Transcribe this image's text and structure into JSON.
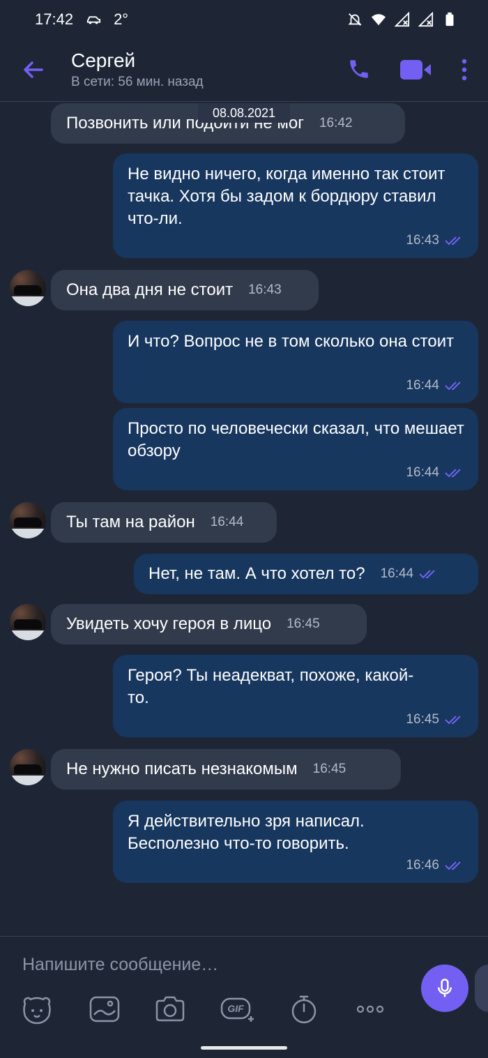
{
  "status_bar": {
    "time": "17:42",
    "temperature": "2°"
  },
  "header": {
    "contact_name": "Сергей",
    "contact_status": "В сети: 56 мин. назад"
  },
  "chat": {
    "date_label": "08.08.2021",
    "messages": [
      {
        "dir": "in",
        "text": "Позвонить или подойти не мог",
        "time": "16:42"
      },
      {
        "dir": "out",
        "text": "Не видно ничего, когда именно так стоит тачка. Хотя бы задом к бордюру ставил что-ли.",
        "time": "16:43"
      },
      {
        "dir": "in",
        "text": "Она два дня не стоит",
        "time": "16:43"
      },
      {
        "dir": "out",
        "text": "И что? Вопрос не в том сколько она стоит",
        "time": "16:44"
      },
      {
        "dir": "out",
        "text": "Просто по человечески сказал, что мешает обзору",
        "time": "16:44"
      },
      {
        "dir": "in",
        "text": "Ты там на район",
        "time": "16:44"
      },
      {
        "dir": "out",
        "text": "Нет, не там. А что хотел то?",
        "time": "16:44"
      },
      {
        "dir": "in",
        "text": "Увидеть хочу героя в лицо",
        "time": "16:45"
      },
      {
        "dir": "out",
        "text": "Героя? Ты неадекват, похоже, какой-то.",
        "time": "16:45"
      },
      {
        "dir": "in",
        "text": "Не нужно писать незнакомым",
        "time": "16:45"
      },
      {
        "dir": "out",
        "text": "Я действительно зря написал. Бесполезно что-то говорить.",
        "time": "16:46"
      }
    ]
  },
  "composer": {
    "placeholder": "Напишите сообщение…",
    "gif_label": "GIF"
  },
  "colors": {
    "accent": "#7360f2",
    "background": "#1e2636",
    "incoming_bubble": "#323b4c",
    "outgoing_bubble": "#17375f"
  },
  "icons": [
    "back-arrow-icon",
    "phone-icon",
    "video-camera-icon",
    "more-vertical-icon",
    "sticker-icon",
    "gallery-icon",
    "camera-icon",
    "gif-icon",
    "timer-icon",
    "more-horizontal-icon",
    "microphone-icon"
  ]
}
